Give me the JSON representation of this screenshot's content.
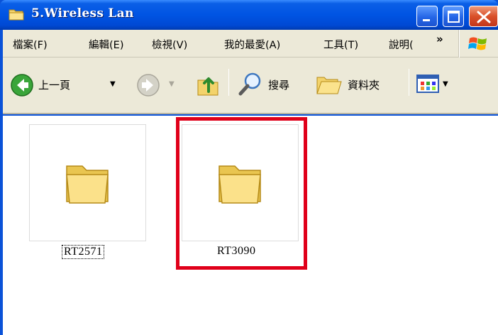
{
  "window": {
    "title": "5.Wireless Lan",
    "title_icon": "folder-icon",
    "controls": [
      "minimize-icon",
      "maximize-icon",
      "close-icon"
    ]
  },
  "menubar": {
    "items": [
      "檔案(F)",
      "編輯(E)",
      "檢視(V)",
      "我的最愛(A)",
      "工具(T)",
      "說明("
    ],
    "overflow": "»"
  },
  "toolbar": {
    "back_label": "上一頁",
    "search_label": "搜尋",
    "folders_label": "資料夾"
  },
  "folders": [
    {
      "name": "RT2571",
      "selected_focus": true
    },
    {
      "name": "RT3090",
      "highlighted": true
    }
  ],
  "colors": {
    "titlebar": "#0054e3",
    "highlight": "#e0001a",
    "chrome": "#ece9d8"
  }
}
